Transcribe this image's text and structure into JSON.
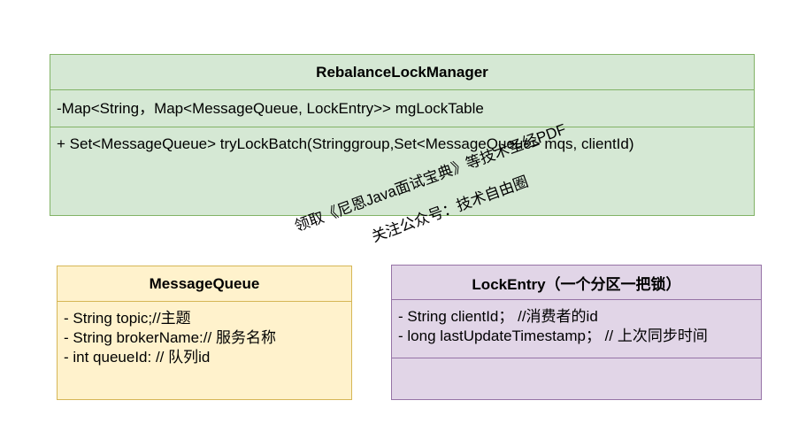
{
  "colors": {
    "green_fill": "#d5e8d4",
    "green_border": "#82b366",
    "yellow_fill": "#fff2cc",
    "yellow_border": "#d6b656",
    "purple_fill": "#e1d5e7",
    "purple_border": "#9673a6"
  },
  "classes": {
    "rebalance_lock_manager": {
      "name": "RebalanceLockManager",
      "attributes": [
        "-Map<String，Map<MessageQueue, LockEntry>> mgLockTable"
      ],
      "operations": [
        "+ Set<MessageQueue> tryLockBatch(Stringgroup,Set<MessageQueue> mqs, clientId)"
      ]
    },
    "message_queue": {
      "name": "MessageQueue",
      "attributes": [
        "- String topic;//主题",
        "- String brokerName:// 服务名称",
        "- int queueId: // 队列id"
      ]
    },
    "lock_entry": {
      "name": "LockEntry（一个分区一把锁）",
      "attributes": [
        "- String clientId； //消费者的id",
        "- long lastUpdateTimestamp； // 上次同步时间"
      ]
    }
  },
  "watermark": {
    "line1": "领取《尼恩Java面试宝典》等技术圣经PDF",
    "line2": "关注公众号：技术自由圈"
  }
}
